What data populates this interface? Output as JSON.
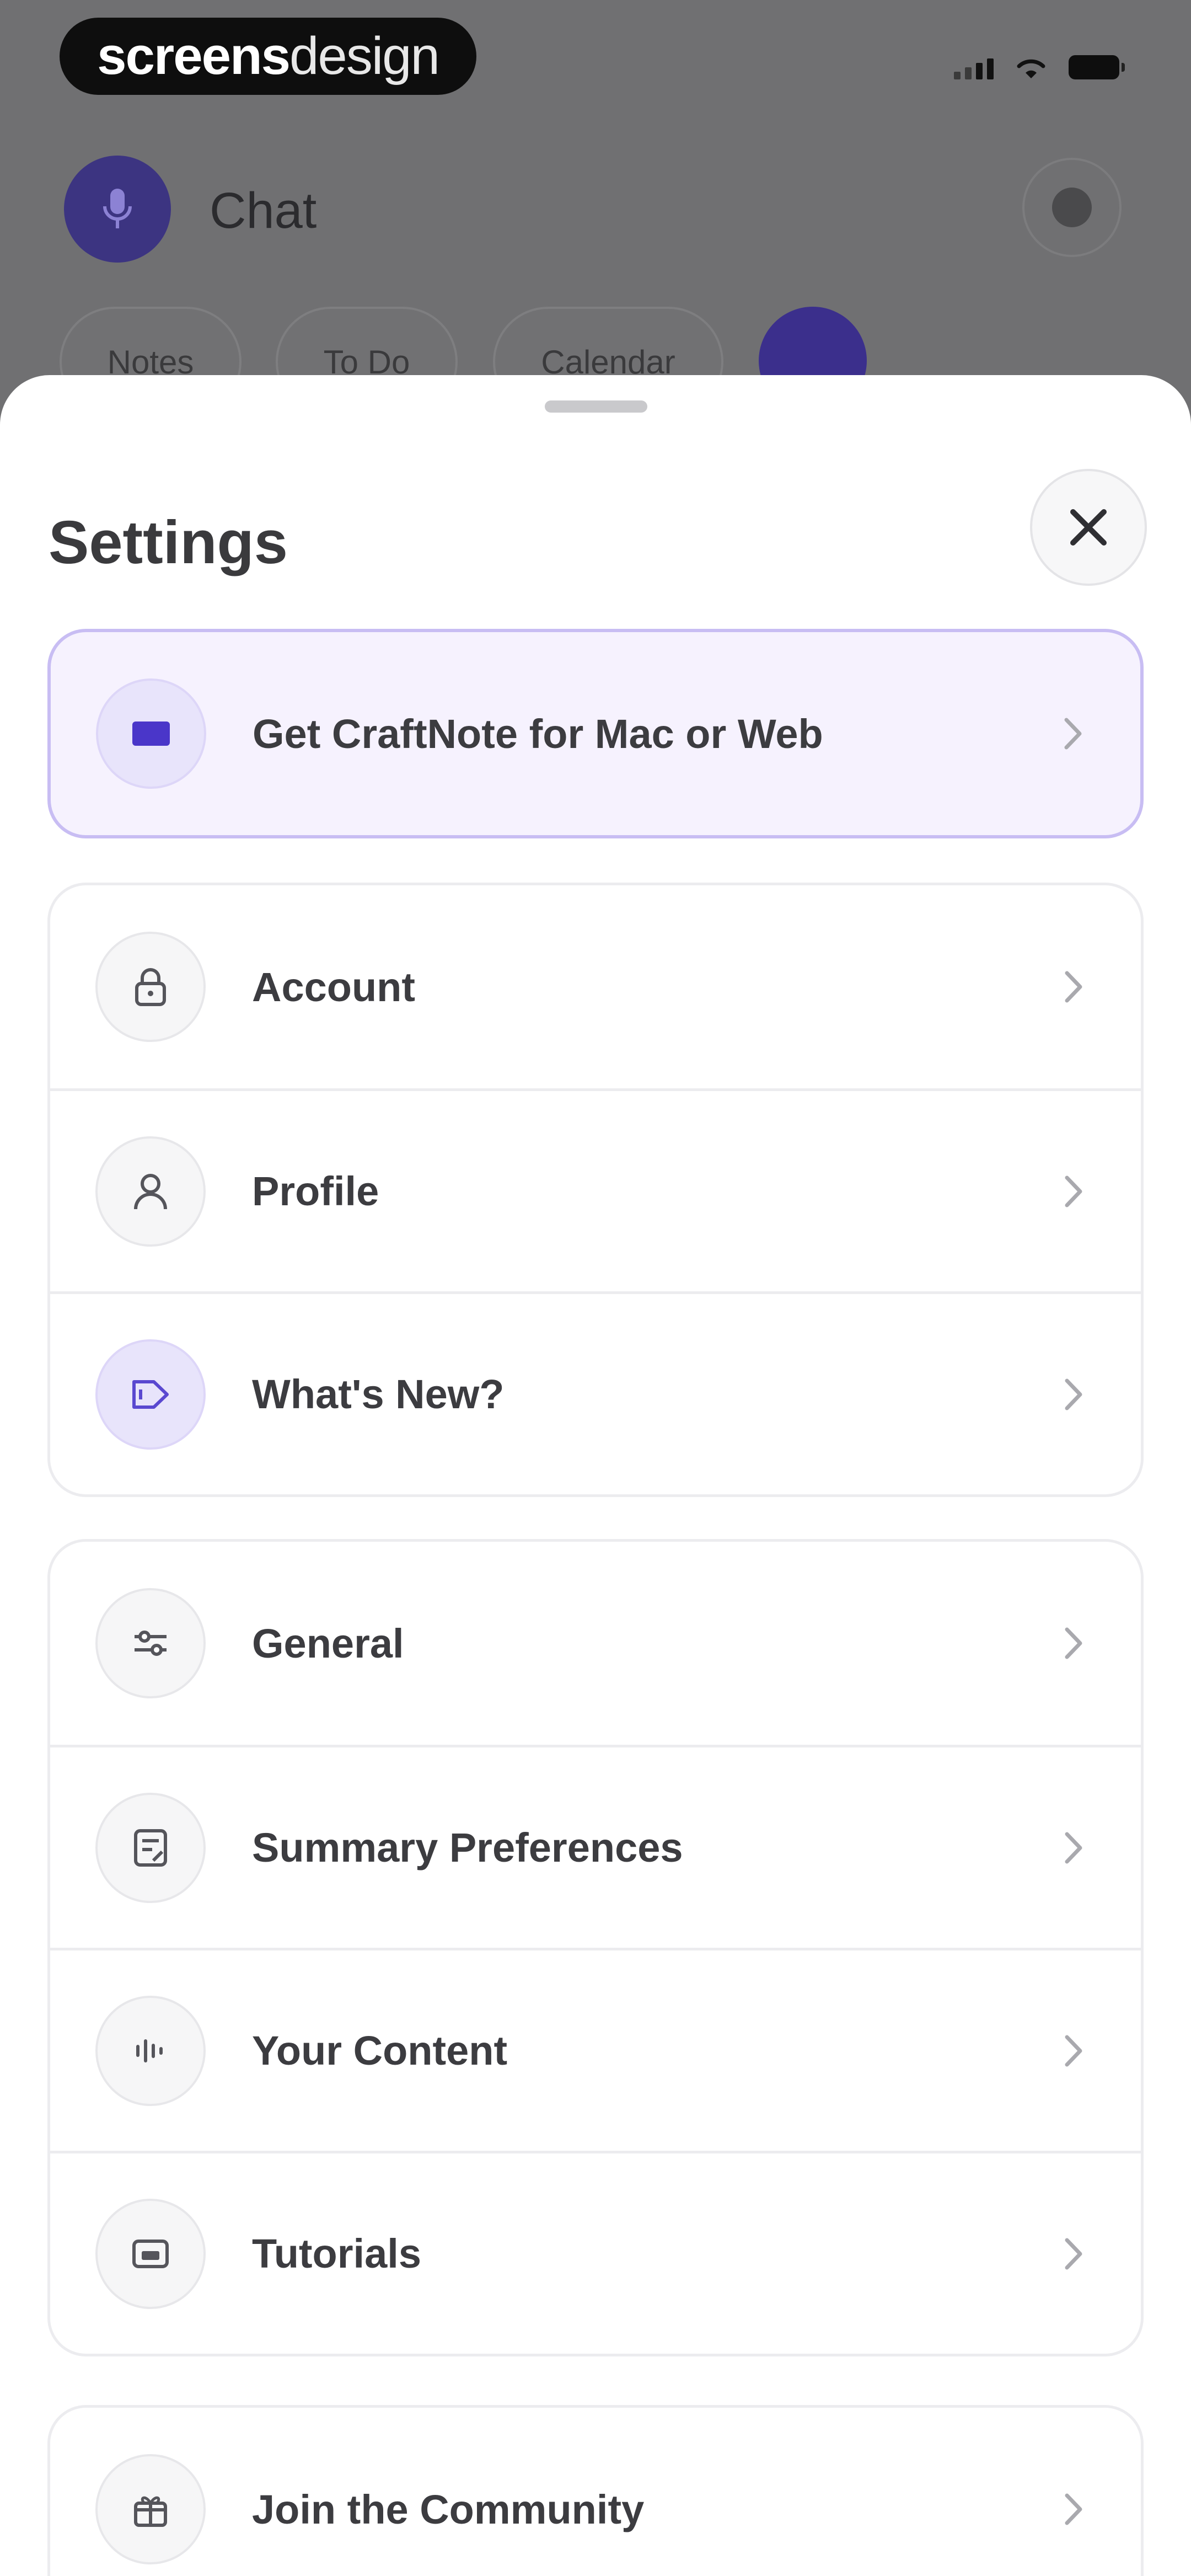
{
  "watermark": {
    "part1": "screens",
    "part2": "design"
  },
  "background_app": {
    "title": "Chat",
    "chips": [
      "Notes",
      "To Do",
      "Calendar"
    ]
  },
  "settings": {
    "title": "Settings",
    "promo": {
      "label": "Get CraftNote for Mac or Web",
      "icon": "laptop-icon"
    },
    "group1": [
      {
        "label": "Account",
        "icon": "lock-icon"
      },
      {
        "label": "Profile",
        "icon": "user-icon"
      },
      {
        "label": "What's New?",
        "icon": "megaphone-icon"
      }
    ],
    "group2": [
      {
        "label": "General",
        "icon": "sliders-icon"
      },
      {
        "label": "Summary Preferences",
        "icon": "document-edit-icon"
      },
      {
        "label": "Your Content",
        "icon": "audio-wave-icon"
      },
      {
        "label": "Tutorials",
        "icon": "tv-icon"
      }
    ],
    "group3": [
      {
        "label": "Join the Community",
        "icon": "gift-icon"
      }
    ]
  },
  "colors": {
    "accent": "#4a36c9",
    "promo_bg": "#f6f2fe",
    "promo_border": "#c8bdf3"
  }
}
